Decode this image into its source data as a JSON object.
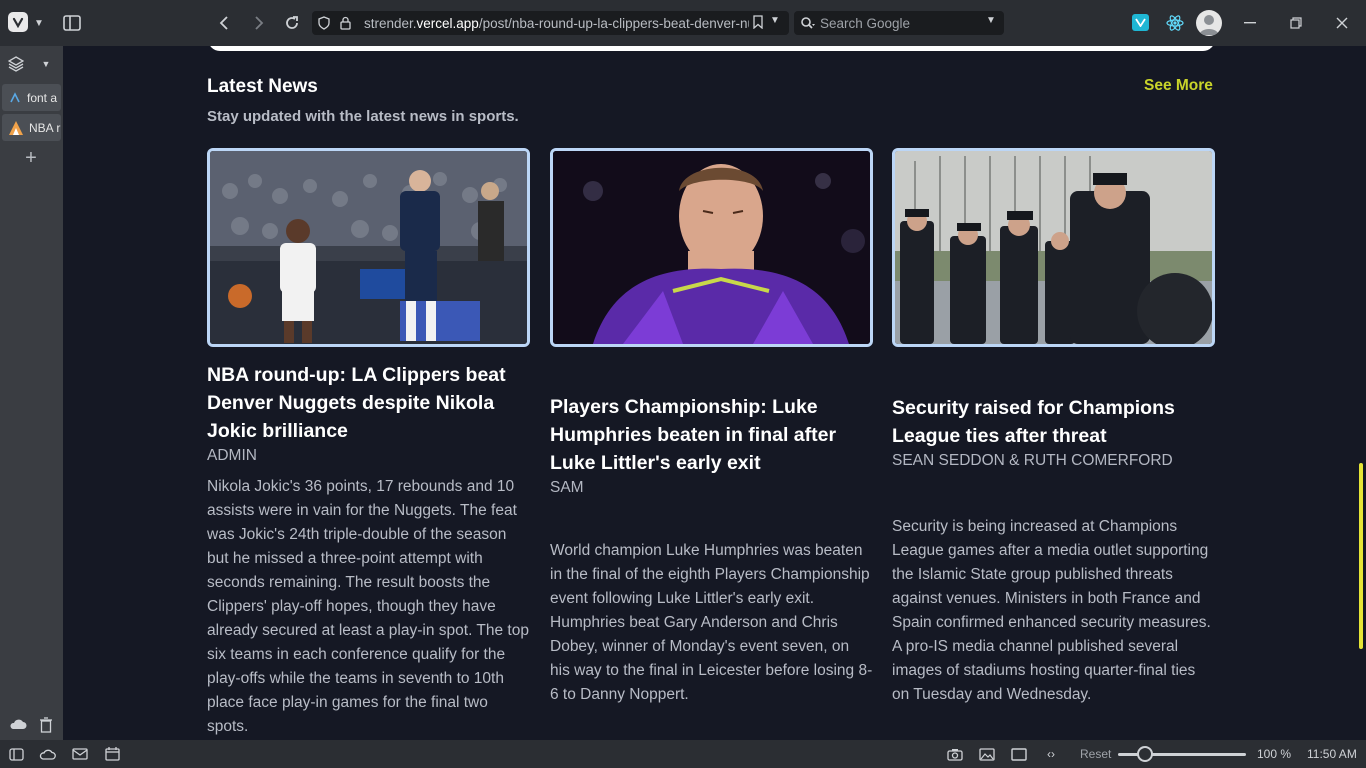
{
  "browser": {
    "url_prefix": "strender.",
    "url_domain": "vercel.app",
    "url_path": "/post/nba-round-up-la-clippers-beat-denver-nu",
    "search_placeholder": "Search Google"
  },
  "sidebar": {
    "tabs": [
      {
        "label": "font a"
      },
      {
        "label": "NBA r"
      }
    ]
  },
  "status": {
    "reset_label": "Reset",
    "zoom": "100 %",
    "time": "11:50 AM"
  },
  "section": {
    "title": "Latest News",
    "subtitle": "Stay updated with the latest news in sports.",
    "see_more": "See More"
  },
  "articles": [
    {
      "title": "NBA round-up: LA Clippers beat Denver Nuggets despite Nikola Jokic brilliance",
      "author": "ADMIN",
      "description": "Nikola Jokic's 36 points, 17 rebounds and 10 assists were in vain for the Nuggets. The feat was Jokic's 24th triple-double of the season but he missed a three-point attempt with seconds remaining. The result boosts the Clippers' play-off hopes, though they have already secured at least a play-in spot. The top six teams in each conference qualify for the play-offs while the teams in seventh to 10th place face play-in games for the final two spots."
    },
    {
      "title": "Players Championship: Luke Humphries beaten in final after Luke Littler's early exit",
      "author": "SAM",
      "description": "World champion Luke Humphries was beaten in the final of the eighth Players Championship event following Luke Littler's early exit. Humphries beat Gary Anderson and Chris Dobey, winner of Monday's event seven, on his way to the final in Leicester before losing 8-6 to Danny Noppert."
    },
    {
      "title": "Security raised for Champions League ties after threat",
      "author": "SEAN SEDDON & RUTH COMERFORD",
      "description": "Security is being increased at Champions League games after a media outlet supporting the Islamic State group published threats against venues. Ministers in both France and Spain confirmed enhanced security measures. A pro-IS media channel published several images of stadiums hosting quarter-final ties on Tuesday and Wednesday."
    }
  ]
}
